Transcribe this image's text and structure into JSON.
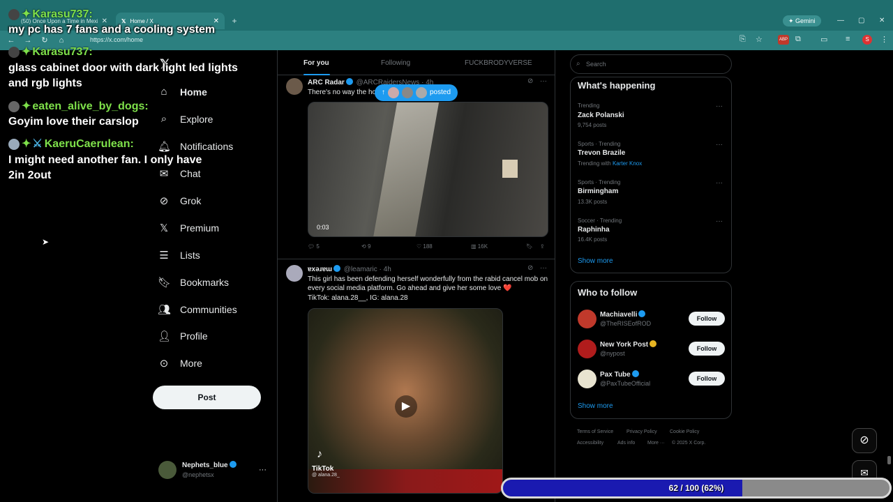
{
  "browser": {
    "tabs": [
      {
        "title": "(50) Once Upon a Time in Mexi..."
      },
      {
        "title": "Home / X"
      }
    ],
    "url": "https://x.com/home",
    "gemini_label": "Gemini",
    "profile_initial": "S"
  },
  "chat": [
    {
      "user": "Karasu737:",
      "message": "my pc has 7 fans and a cooling system"
    },
    {
      "user": "Karasu737:",
      "message": "glass cabinet door with dark light led lights and rgb lights"
    },
    {
      "user": "eaten_alive_by_dogs:",
      "message": "Goyim love their carslop"
    },
    {
      "user": "KaeruCaerulean:",
      "message": "I might need another fan. I only have 2in 2out"
    }
  ],
  "sidebar": {
    "items": [
      {
        "label": "Home",
        "icon": "home-icon"
      },
      {
        "label": "Explore",
        "icon": "search-icon"
      },
      {
        "label": "Notifications",
        "icon": "bell-icon"
      },
      {
        "label": "Chat",
        "icon": "mail-icon"
      },
      {
        "label": "Grok",
        "icon": "grok-icon"
      },
      {
        "label": "Premium",
        "icon": "x-icon"
      },
      {
        "label": "Lists",
        "icon": "list-icon"
      },
      {
        "label": "Bookmarks",
        "icon": "bookmark-icon"
      },
      {
        "label": "Communities",
        "icon": "people-icon"
      },
      {
        "label": "Profile",
        "icon": "person-icon"
      },
      {
        "label": "More",
        "icon": "more-icon"
      }
    ],
    "post_label": "Post",
    "account": {
      "name": "Nephets_blue",
      "handle": "@nephetsx"
    }
  },
  "feed": {
    "tabs": [
      "For you",
      "Following",
      "FUCKBRODYVERSE"
    ],
    "new_posts_pill": "posted",
    "tweets": [
      {
        "name": "ARC Radar",
        "handle": "@ARCRaidersNews · 4h",
        "text": "There's no way the ho... and he was right 😭",
        "video_time": "0:03",
        "stats": {
          "replies": "5",
          "reposts": "9",
          "likes": "188",
          "views": "16K"
        }
      },
      {
        "name": "ɐxǝɹɐɯ",
        "handle": "@leamaric · 4h",
        "text": "This girl has been defending herself wonderfully from the rabid cancel mob on every social media platform. Go ahead and give her some love ❤️",
        "text2": "TikTok: alana.28__, IG: alana.28",
        "tiktok": "TikTok",
        "tiktok_user": "@ alana.28_"
      }
    ]
  },
  "right": {
    "search_placeholder": "Search",
    "happening_title": "What's happening",
    "trends": [
      {
        "meta": "Trending",
        "name": "Zack Polanski",
        "sub": "9,754 posts"
      },
      {
        "meta": "Sports · Trending",
        "name": "Trevon Brazile",
        "sub": "Trending with",
        "sub_link": "Karter Knox"
      },
      {
        "meta": "Sports · Trending",
        "name": "Birmingham",
        "sub": "13.3K posts"
      },
      {
        "meta": "Soccer · Trending",
        "name": "Raphinha",
        "sub": "16.4K posts"
      }
    ],
    "show_more": "Show more",
    "wtf_title": "Who to follow",
    "follow": [
      {
        "name": "Machiavelli",
        "handle": "@TheRISEofROD"
      },
      {
        "name": "New York Post",
        "handle": "@nypost"
      },
      {
        "name": "Pax Tube",
        "handle": "@PaxTubeOfficial"
      }
    ],
    "follow_label": "Follow",
    "footer": [
      "Terms of Service",
      "Privacy Policy",
      "Cookie Policy",
      "Accessibility",
      "Ads info",
      "More ···",
      "© 2025 X Corp."
    ]
  },
  "progress": {
    "label": "62 / 100 (62%)",
    "fraction": 0.62
  },
  "colors": {
    "accent": "#1d9bf0",
    "chat_name": "#7ee04a",
    "progress_fill": "#1a1ab0"
  }
}
